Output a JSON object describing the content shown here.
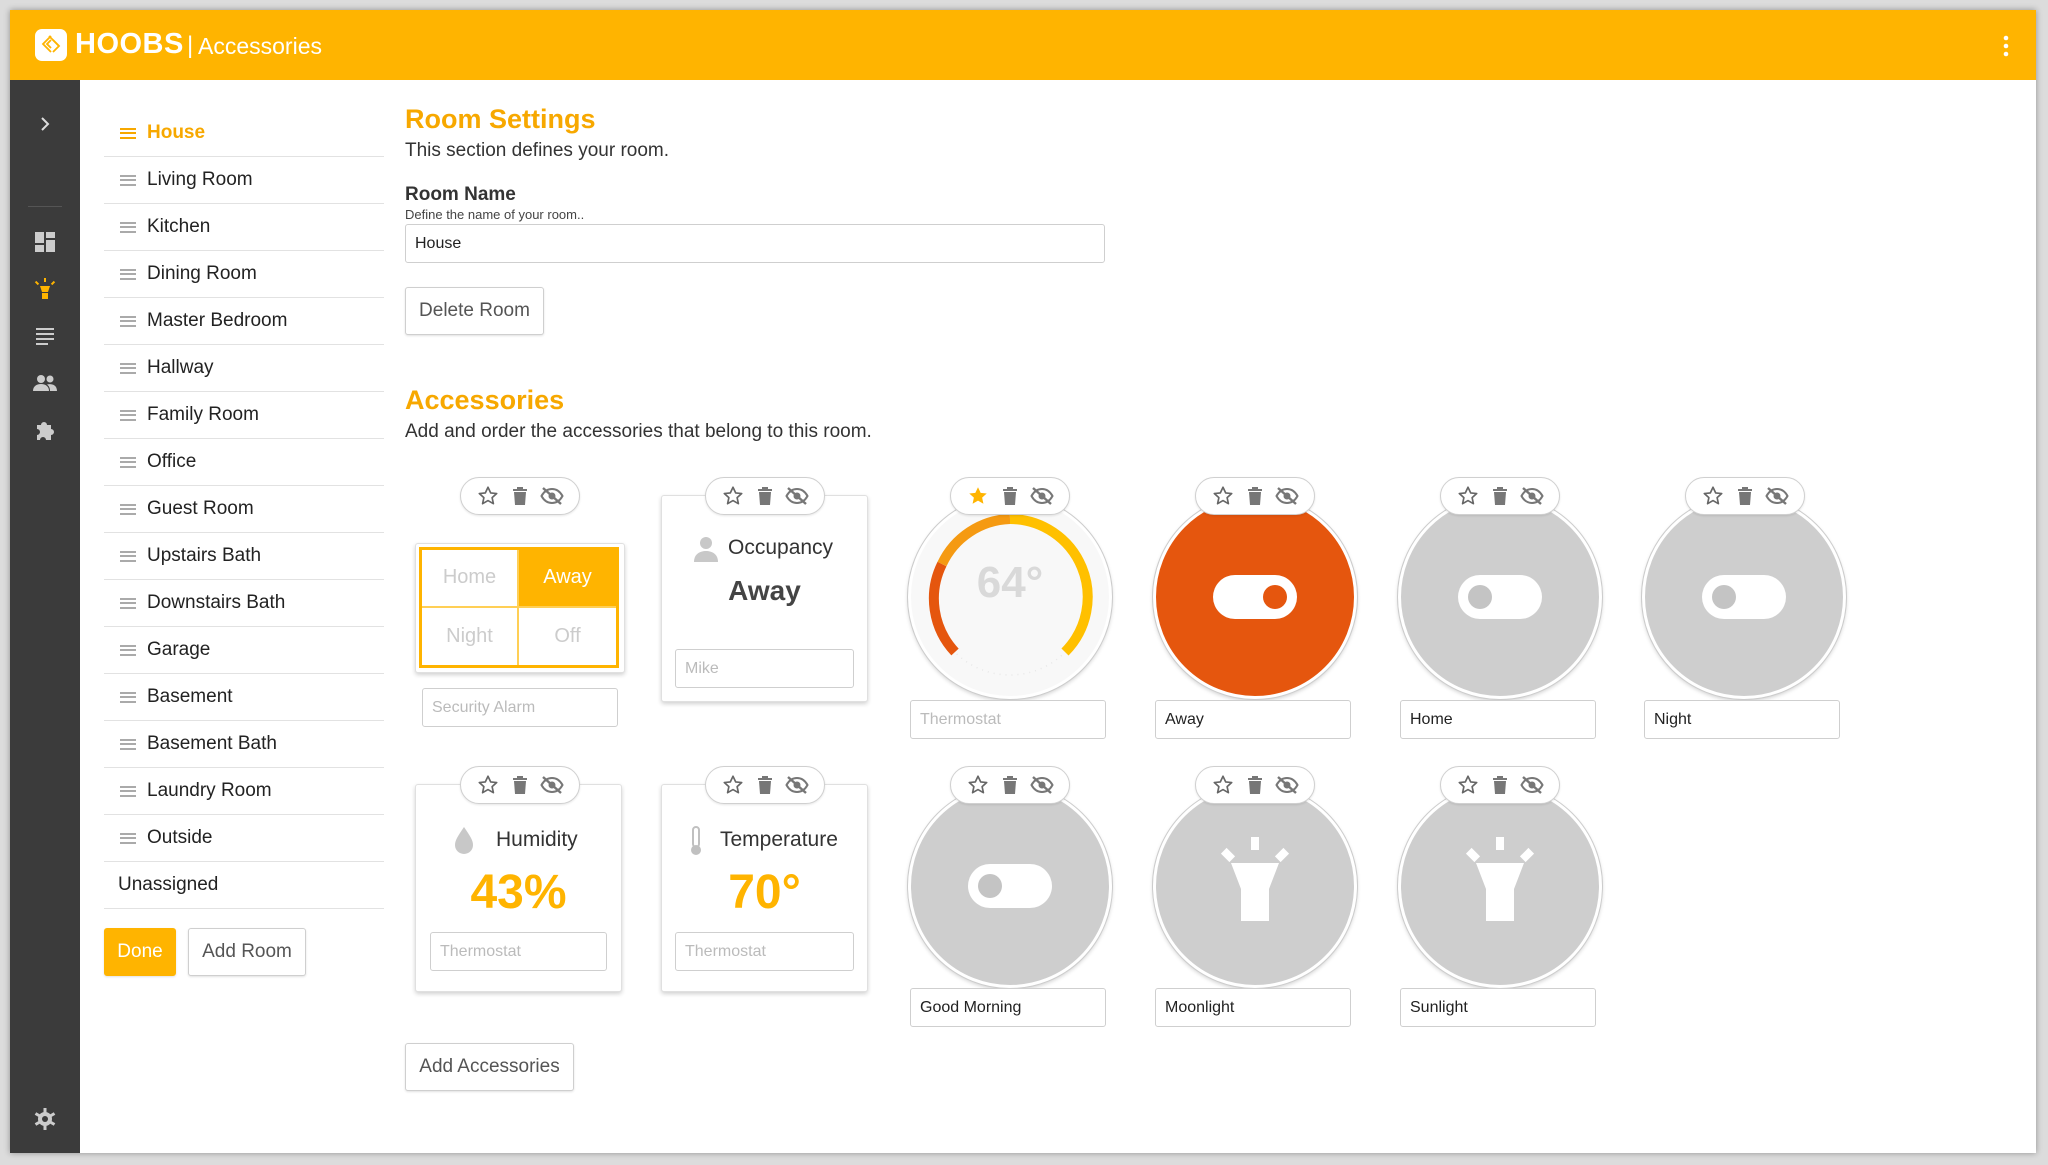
{
  "app": {
    "brand": "HOOBS",
    "separator": "|",
    "section": "Accessories"
  },
  "colors": {
    "accent": "#ffb400",
    "active_toggle": "#e5560e",
    "sidebar": "#3b3b3b"
  },
  "rail": {
    "icons": [
      "chevron-right-icon",
      "dashboard-icon",
      "lightbulb-icon",
      "list-icon",
      "users-icon",
      "puzzle-icon",
      "settings-icon"
    ],
    "active": "lightbulb-icon"
  },
  "rooms": [
    "House",
    "Living Room",
    "Kitchen",
    "Dining Room",
    "Master Bedroom",
    "Hallway",
    "Family Room",
    "Office",
    "Guest Room",
    "Upstairs Bath",
    "Downstairs Bath",
    "Garage",
    "Basement",
    "Basement Bath",
    "Laundry Room",
    "Outside"
  ],
  "active_room": "House",
  "unassigned_label": "Unassigned",
  "buttons": {
    "done": "Done",
    "add_room": "Add Room",
    "delete_room": "Delete Room",
    "add_accessories": "Add Accessories"
  },
  "room_settings": {
    "title": "Room Settings",
    "description": "This section defines your room.",
    "room_name_label": "Room Name",
    "room_name_help": "Define the name of your room..",
    "room_name_value": "House"
  },
  "accessories_section": {
    "title": "Accessories",
    "description": "Add and order the accessories that belong to this room."
  },
  "accessories": {
    "security": {
      "options": [
        "Home",
        "Away",
        "Night",
        "Off"
      ],
      "selected": "Away",
      "name_placeholder": "Security Alarm"
    },
    "occupancy": {
      "title": "Occupancy",
      "value": "Away",
      "name_placeholder": "Mike"
    },
    "thermostat": {
      "value": "64°",
      "name_placeholder": "Thermostat",
      "favorite": true
    },
    "away": {
      "name": "Away",
      "on": true
    },
    "home": {
      "name": "Home",
      "on": false
    },
    "night": {
      "name": "Night",
      "on": false
    },
    "humidity": {
      "title": "Humidity",
      "value": "43%",
      "name_placeholder": "Thermostat"
    },
    "temperature": {
      "title": "Temperature",
      "value": "70°",
      "name_placeholder": "Thermostat"
    },
    "good_morning": {
      "name": "Good Morning",
      "on": false
    },
    "moonlight": {
      "name": "Moonlight"
    },
    "sunlight": {
      "name": "Sunlight"
    }
  }
}
